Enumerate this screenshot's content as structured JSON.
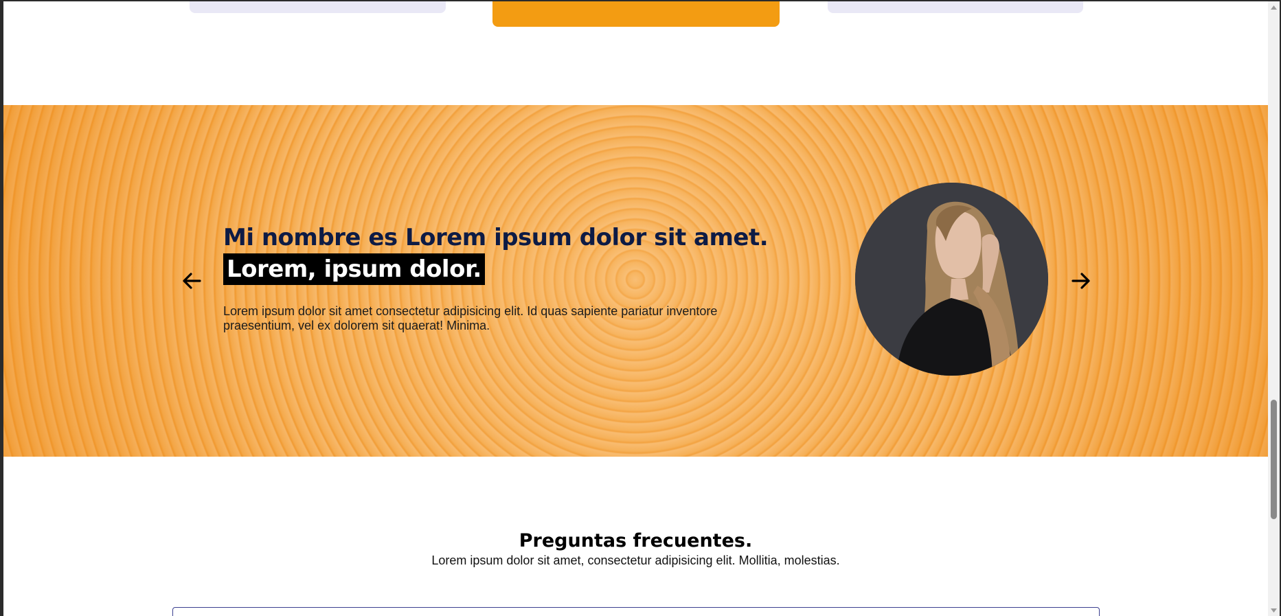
{
  "testimonial": {
    "headline": "Mi nombre es Lorem ipsum dolor sit amet.",
    "highlight": "Lorem, ipsum dolor.",
    "description": "Lorem ipsum dolor sit amet consectetur adipisicing elit. Id quas sapiente pariatur inventore praesentium, vel ex dolorem sit quaerat! Minima.",
    "prev_icon": "arrow-left-icon",
    "next_icon": "arrow-right-icon"
  },
  "faq": {
    "title": "Preguntas frecuentes.",
    "subtitle": "Lorem ipsum dolor sit amet, consectetur adipisicing elit. Mollitia, molestias."
  },
  "colors": {
    "accent": "#f39c12",
    "headline": "#0d1b45",
    "card_bg": "#e9e8f6",
    "faq_border": "#3b3f8f"
  }
}
